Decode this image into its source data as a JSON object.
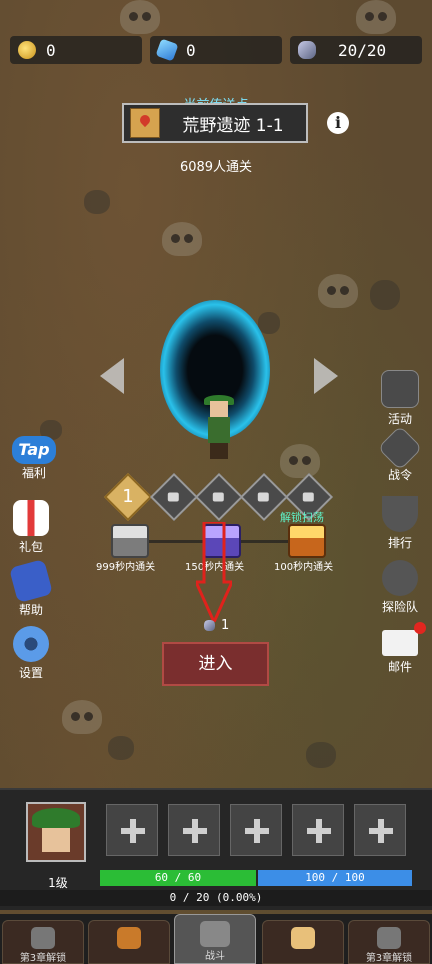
{
  "resources": {
    "gold": "0",
    "gems": "0",
    "energy": "20/20"
  },
  "stage": {
    "portal_label": "当前传送点",
    "name": "荒野遗迹 1-1",
    "clear_count": "6089人通关",
    "info": "i"
  },
  "nodes": [
    "1"
  ],
  "chests": [
    {
      "caption": "999秒内通关"
    },
    {
      "caption": "150秒内通关"
    },
    {
      "caption": "100秒内通关"
    }
  ],
  "sweep_label": "解锁扫荡",
  "cost": "1",
  "enter_label": "进入",
  "left_menu": [
    {
      "label": "福利",
      "badge": "Tap"
    },
    {
      "label": "礼包"
    },
    {
      "label": "帮助"
    },
    {
      "label": "设置"
    }
  ],
  "right_menu": [
    {
      "label": "活动"
    },
    {
      "label": "战令"
    },
    {
      "label": "排行"
    },
    {
      "label": "探险队"
    },
    {
      "label": "邮件"
    }
  ],
  "hero": {
    "level": "1级",
    "hp": "60 / 60",
    "mp": "100 / 100",
    "exp": "0 / 20 (0.00%)"
  },
  "tabs": [
    {
      "label": "第3章解锁"
    },
    {
      "label": ""
    },
    {
      "label": "战斗"
    },
    {
      "label": ""
    },
    {
      "label": "第3章解锁"
    }
  ]
}
